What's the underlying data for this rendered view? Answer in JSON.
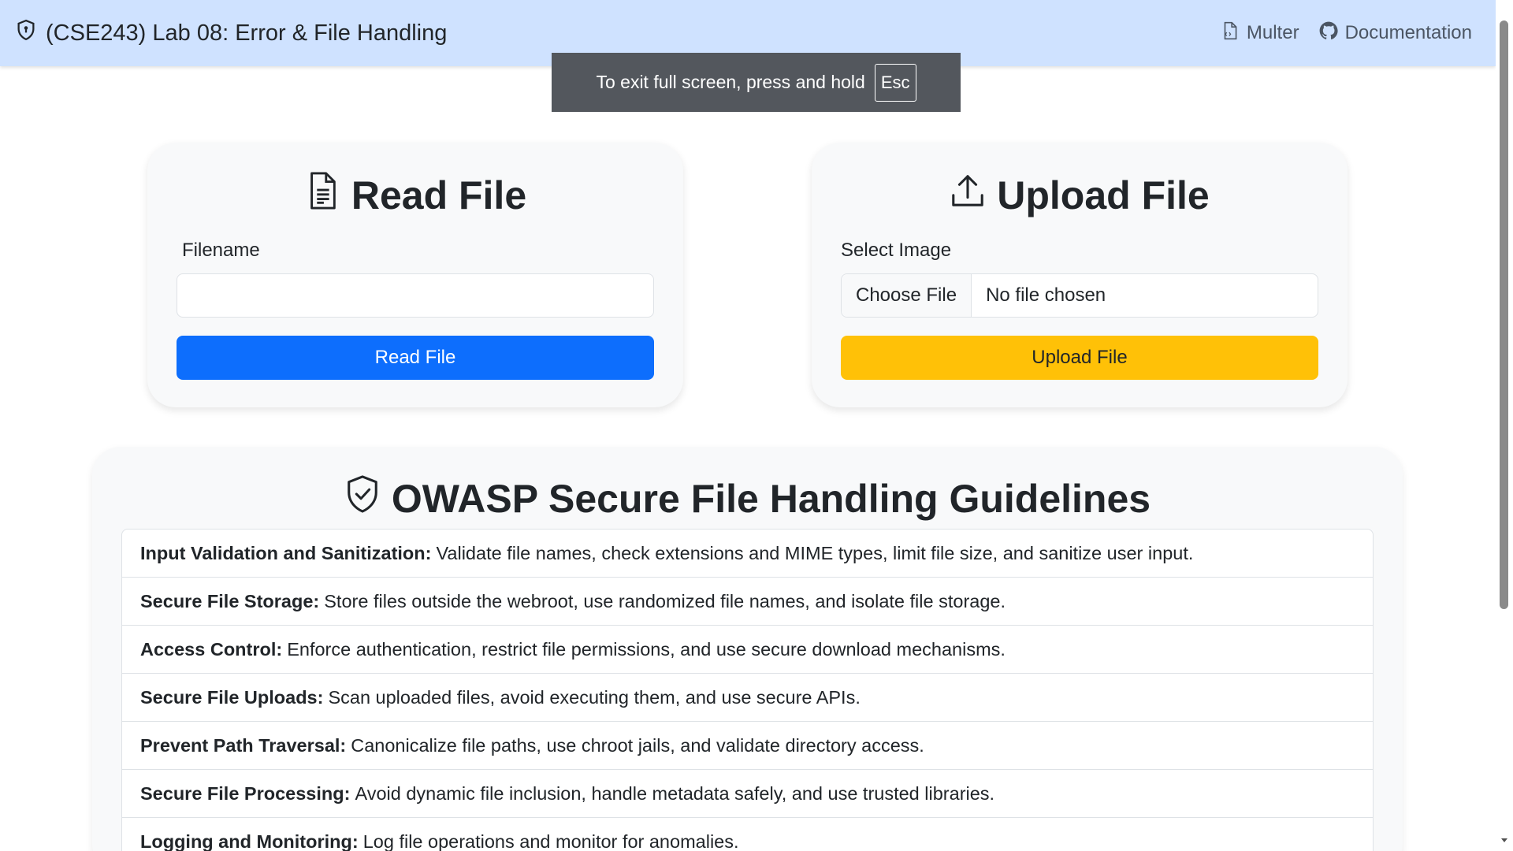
{
  "navbar": {
    "brand_icon": "shield-lock-icon",
    "title": "(CSE243) Lab 08: Error & File Handling",
    "links": [
      {
        "label": "Multer",
        "icon": "file-code-icon"
      },
      {
        "label": "Documentation",
        "icon": "github-icon"
      }
    ]
  },
  "fullscreen_notice": {
    "text": "To exit full screen, press and hold",
    "key": "Esc"
  },
  "read_card": {
    "icon": "file-text-icon",
    "title": "Read File",
    "label": "Filename",
    "input_value": "",
    "button_label": "Read File",
    "button_color": "#0d6efd"
  },
  "upload_card": {
    "icon": "upload-icon",
    "title": "Upload File",
    "label": "Select Image",
    "choose_label": "Choose File",
    "file_status": "No file chosen",
    "button_label": "Upload File",
    "button_color": "#ffc107"
  },
  "guidelines": {
    "icon": "shield-check-icon",
    "title": "OWASP Secure File Handling Guidelines",
    "items": [
      {
        "heading": "Input Validation and Sanitization:",
        "text": "Validate file names, check extensions and MIME types, limit file size, and sanitize user input."
      },
      {
        "heading": "Secure File Storage:",
        "text": "Store files outside the webroot, use randomized file names, and isolate file storage."
      },
      {
        "heading": "Access Control:",
        "text": "Enforce authentication, restrict file permissions, and use secure download mechanisms."
      },
      {
        "heading": "Secure File Uploads:",
        "text": "Scan uploaded files, avoid executing them, and use secure APIs."
      },
      {
        "heading": "Prevent Path Traversal:",
        "text": "Canonicalize file paths, use chroot jails, and validate directory access."
      },
      {
        "heading": "Secure File Processing:",
        "text": "Avoid dynamic file inclusion, handle metadata safely, and use trusted libraries."
      },
      {
        "heading": "Logging and Monitoring:",
        "text": "Log file operations and monitor for anomalies."
      }
    ]
  },
  "colors": {
    "navbar_bg": "#cfe2ff",
    "card_bg": "#f8f9fa",
    "primary": "#0d6efd",
    "warning": "#ffc107"
  }
}
